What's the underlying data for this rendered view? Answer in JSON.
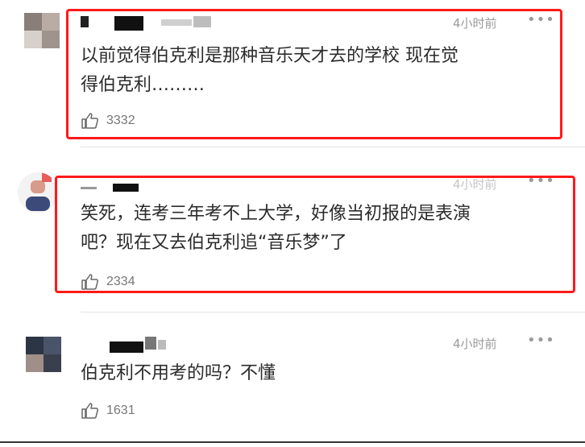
{
  "comments": [
    {
      "time": "4小时前",
      "more": "•••",
      "text_lines": [
        "以前觉得伯克利是那种音乐天才去的学校 现在觉",
        "得伯克利………"
      ],
      "likes": "3332"
    },
    {
      "time": "4小时前",
      "more": "•••",
      "text_lines": [
        "笑死，连考三年考不上大学，好像当初报的是表演",
        "吧？现在又去伯克利追“音乐梦”了"
      ],
      "likes": "2334"
    },
    {
      "time": "4小时前",
      "more": "•••",
      "text_lines": [
        "伯克利不用考的吗？不懂"
      ],
      "likes": "1631"
    }
  ],
  "icons": {
    "like": "thumbs-up-icon",
    "more": "more-dots-icon"
  },
  "colors": {
    "highlight": "#ff1a1a",
    "text": "#2b2b2b",
    "meta": "#9a9a9a"
  }
}
